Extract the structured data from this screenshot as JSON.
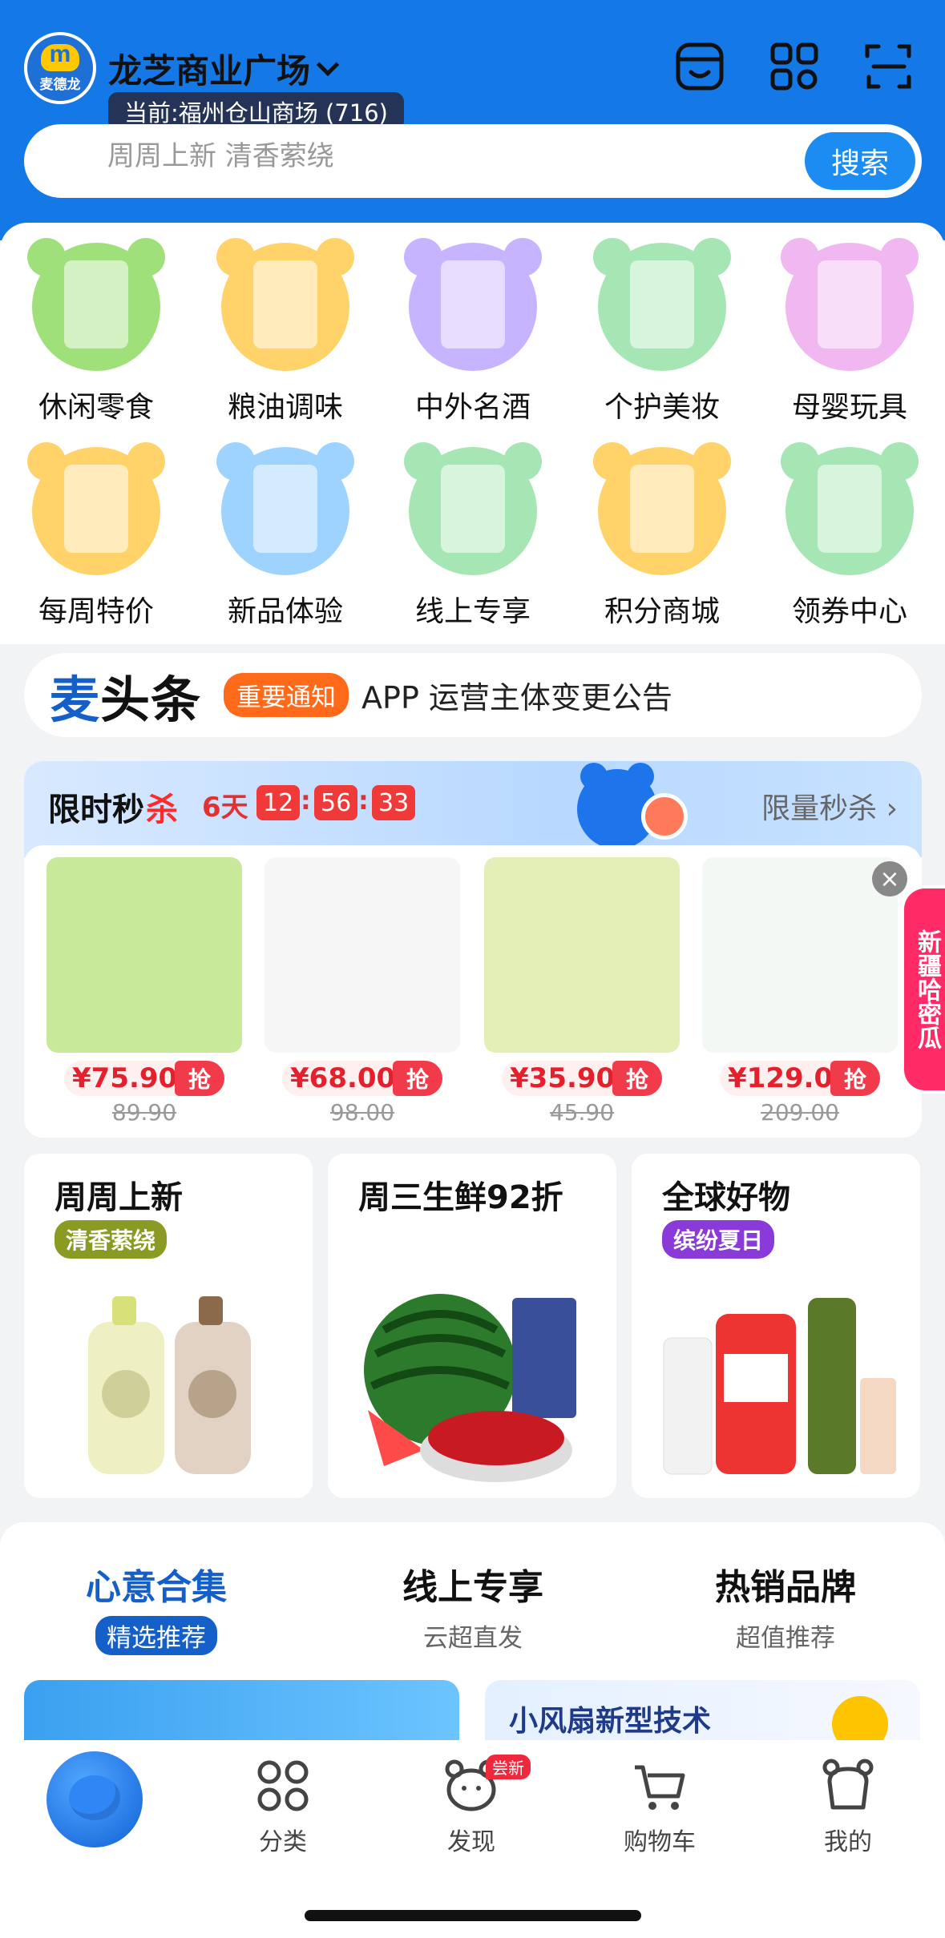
{
  "header": {
    "logo_text": "麦德龙",
    "store_name": "龙芝商业广场",
    "current_store": "当前:福州仓山商场 (716)",
    "search_placeholder": "周周上新 清香萦绕",
    "search_button": "搜索",
    "icons": [
      "store-icon",
      "qr-code-icon",
      "scan-icon"
    ]
  },
  "categories": [
    {
      "label": "休闲零食",
      "color": "#9fe07a",
      "icon": "snacks-icon"
    },
    {
      "label": "粮油调味",
      "color": "#ffd36a",
      "icon": "oil-icon"
    },
    {
      "label": "中外名酒",
      "color": "#c7b4ff",
      "icon": "wine-icon"
    },
    {
      "label": "个护美妆",
      "color": "#a6e6b4",
      "icon": "cosmetics-icon"
    },
    {
      "label": "母婴玩具",
      "color": "#f0b7f0",
      "icon": "baby-toys-icon"
    },
    {
      "label": "每周特价",
      "color": "#ffd36a",
      "icon": "calendar-icon"
    },
    {
      "label": "新品体验",
      "color": "#9fd3ff",
      "icon": "mascot-icon"
    },
    {
      "label": "线上专享",
      "color": "#a6e6b4",
      "icon": "online-icon"
    },
    {
      "label": "积分商城",
      "color": "#ffd36a",
      "icon": "shop-icon"
    },
    {
      "label": "领券中心",
      "color": "#a6e6b4",
      "icon": "coupon-icon"
    }
  ],
  "news": {
    "brand_a": "麦",
    "brand_b": "头条",
    "tag": "重要通知",
    "text": "APP 运营主体变更公告"
  },
  "flash_sale": {
    "title_a": "限时秒",
    "title_b": "杀",
    "days": "6天",
    "hours": "12",
    "minutes": "56",
    "seconds": "33",
    "sep": ":",
    "more": "限量秒杀 ›",
    "grab_label": "抢",
    "items": [
      {
        "price": "¥75.90",
        "original": "89.90",
        "color": "#c8e89a"
      },
      {
        "price": "¥68.00",
        "original": "98.00",
        "color": "#f6f6f6"
      },
      {
        "price": "¥35.90",
        "original": "45.90",
        "color": "#e4efb8"
      },
      {
        "price": "¥129.00",
        "original": "209.00",
        "color": "#f4f8f4"
      }
    ],
    "close": "×"
  },
  "side_banner": "新疆哈密瓜",
  "promos": [
    {
      "title": "周周上新",
      "tag": "清香萦绕",
      "tag_color": "#8a9a22"
    },
    {
      "title": "周三生鲜92折",
      "tag": "",
      "tag_color": "#ffffff"
    },
    {
      "title": "全球好物",
      "tag": "缤纷夏日",
      "tag_color": "#8a3ad8"
    }
  ],
  "tabs": [
    {
      "title": "心意合集",
      "sub": "精选推荐"
    },
    {
      "title": "线上专享",
      "sub": "云超直发"
    },
    {
      "title": "热销品牌",
      "sub": "超值推荐"
    }
  ],
  "bottom_cards": {
    "right_title": "小风扇新型技术"
  },
  "nav": {
    "items": [
      {
        "label": "分类"
      },
      {
        "label": "发现",
        "badge": "尝新"
      },
      {
        "label": "购物车"
      },
      {
        "label": "我的"
      }
    ]
  }
}
